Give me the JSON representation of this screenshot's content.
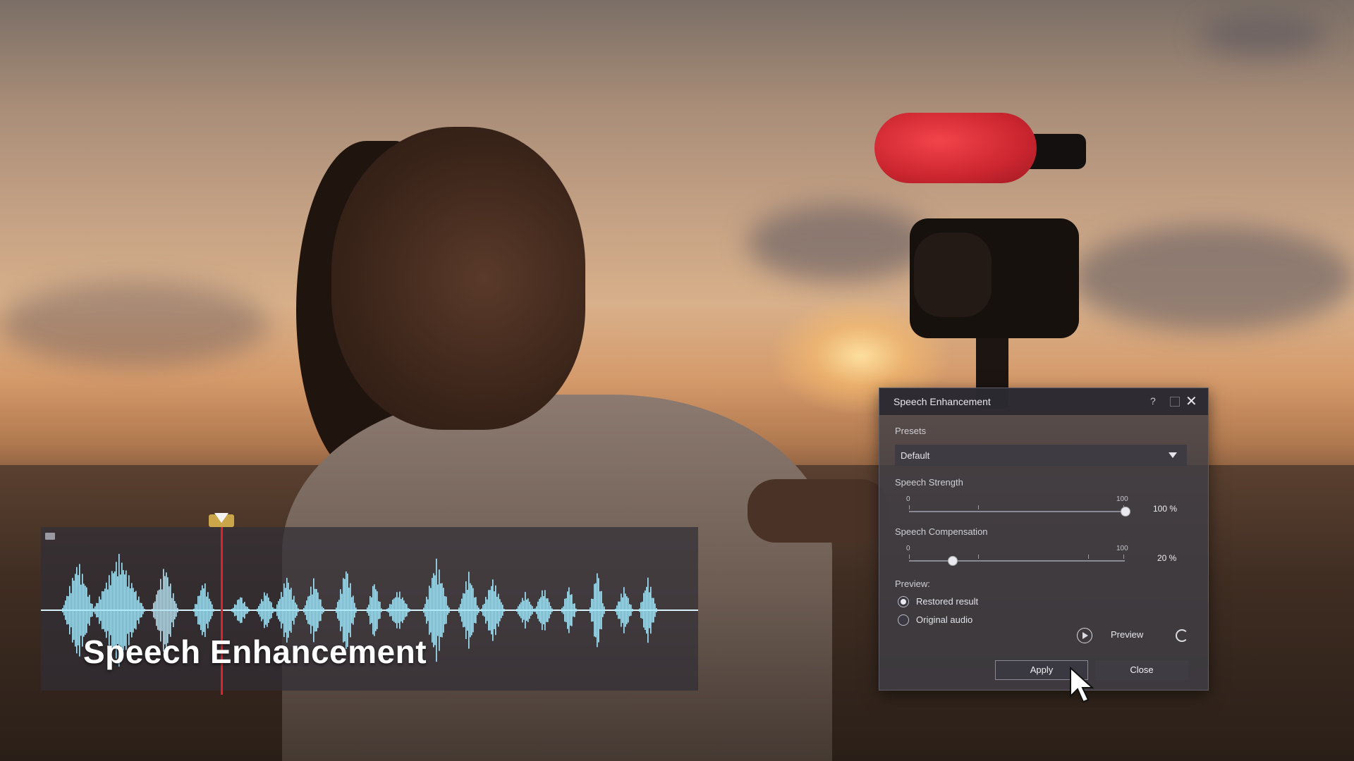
{
  "overlay": {
    "waveform_title": "Speech Enhancement"
  },
  "dialog": {
    "title": "Speech Enhancement",
    "help_label": "?",
    "presets": {
      "label": "Presets",
      "selected": "Default"
    },
    "speech_strength": {
      "label": "Speech Strength",
      "min": "0",
      "max": "100",
      "value": 100,
      "value_text": "100 %"
    },
    "speech_compensation": {
      "label": "Speech Compensation",
      "min": "0",
      "max": "100",
      "value": 20,
      "value_text": "20 %"
    },
    "preview": {
      "label": "Preview:",
      "options": [
        "Restored result",
        "Original audio"
      ],
      "selected": "Restored result",
      "preview_button": "Preview"
    },
    "buttons": {
      "apply": "Apply",
      "close": "Close"
    }
  },
  "colors": {
    "waveform": "#a9e4f7",
    "playhead": "#e0202a",
    "marker": "#caa54a"
  }
}
